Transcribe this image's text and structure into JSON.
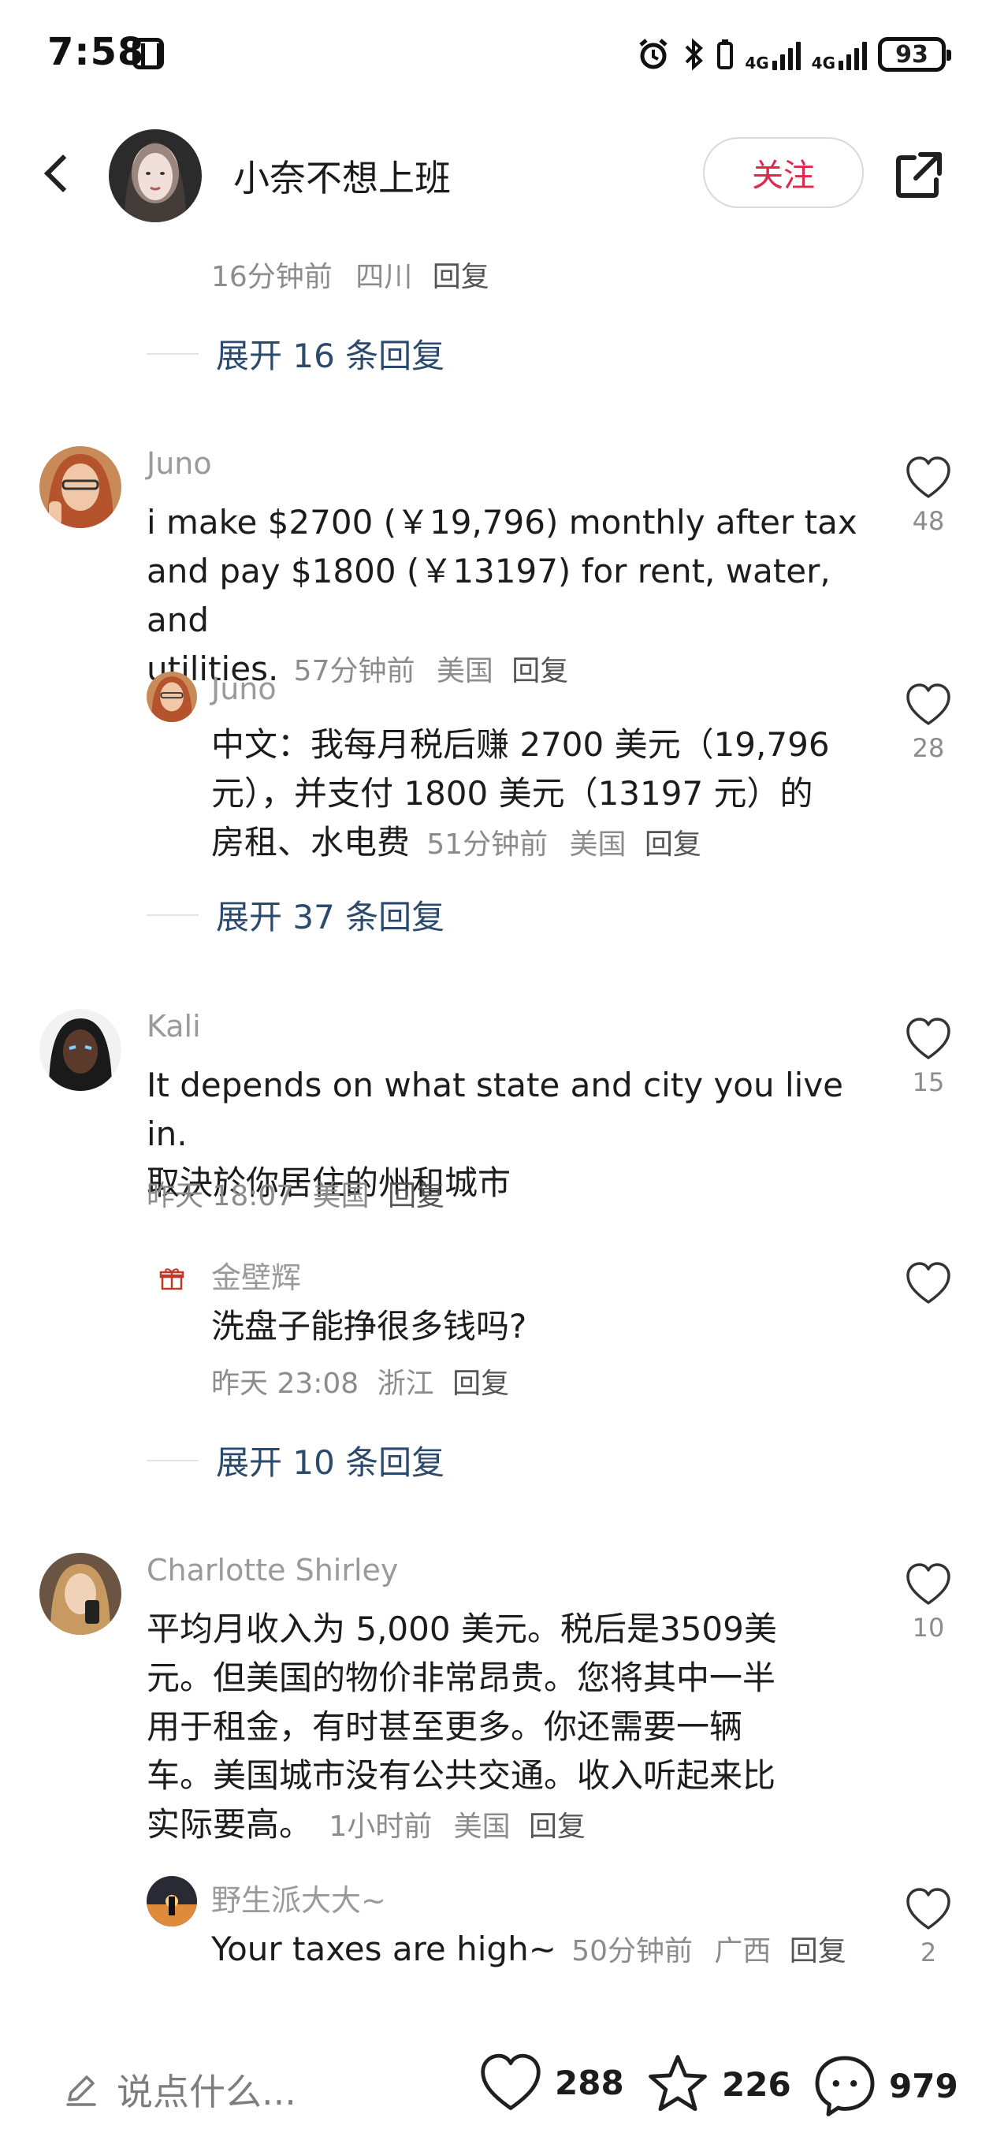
{
  "status_bar": {
    "time": "7:58",
    "network_1": "4G",
    "network_2": "4G",
    "battery": "93"
  },
  "header": {
    "user_name": "小奈不想上班",
    "follow_label": "关注"
  },
  "top_meta": {
    "time": "16分钟前",
    "location": "四川",
    "reply": "回复"
  },
  "expand_1": "展开 16 条回复",
  "comment_juno": {
    "user": "Juno",
    "text": "i make $2700 (￥19,796) monthly after tax and pay $1800 (￥13197) for rent, water, and utilities.",
    "line1": "i make $2700 (￥19,796) monthly after tax",
    "line2": "and pay $1800 (￥13197) for rent, water, and",
    "line3": "utilities.",
    "time": "57分钟前",
    "location": "美国",
    "reply": "回复",
    "likes": "48"
  },
  "reply_juno": {
    "user": "Juno",
    "line1": "中文：我每月税后赚 2700 美元（19,796",
    "line2": "元），并支付 1800 美元（13197 元）的",
    "line3": "房租、水电费",
    "time": "51分钟前",
    "location": "美国",
    "reply": "回复",
    "likes": "28"
  },
  "expand_2": "展开 37 条回复",
  "comment_kali": {
    "user": "Kali",
    "line1": "It depends on what state and city you live in.",
    "line2": "取決於你居住的州和城市",
    "time": "昨天 18:07",
    "location": "美国",
    "reply": "回复",
    "likes": "15"
  },
  "reply_jin": {
    "user": "金壁辉",
    "line1": "洗盘子能挣很多钱吗?",
    "time": "昨天 23:08",
    "location": "浙江",
    "reply": "回复"
  },
  "expand_3": "展开 10 条回复",
  "comment_charlotte": {
    "user": "Charlotte Shirley",
    "line1": "平均月收入为 5,000 美元。税后是3509美",
    "line2": "元。但美国的物价非常昂贵。您将其中一半",
    "line3": "用于租金，有时甚至更多。你还需要一辆",
    "line4": "车。美国城市没有公共交通。收入听起来比",
    "line5": "实际要高。",
    "time": "1小时前",
    "location": "美国",
    "reply": "回复",
    "likes": "10"
  },
  "reply_wild": {
    "user": "野生派大大~",
    "line1": "Your taxes are high~",
    "time": "50分钟前",
    "location": "广西",
    "reply": "回复",
    "likes": "2"
  },
  "bottom_bar": {
    "input_placeholder": "说点什么...",
    "likes": "288",
    "favorites": "226",
    "comments": "979"
  },
  "colors": {
    "accent": "#e0284d",
    "link": "#2b4a6e",
    "meta": "#8c8c8c"
  }
}
